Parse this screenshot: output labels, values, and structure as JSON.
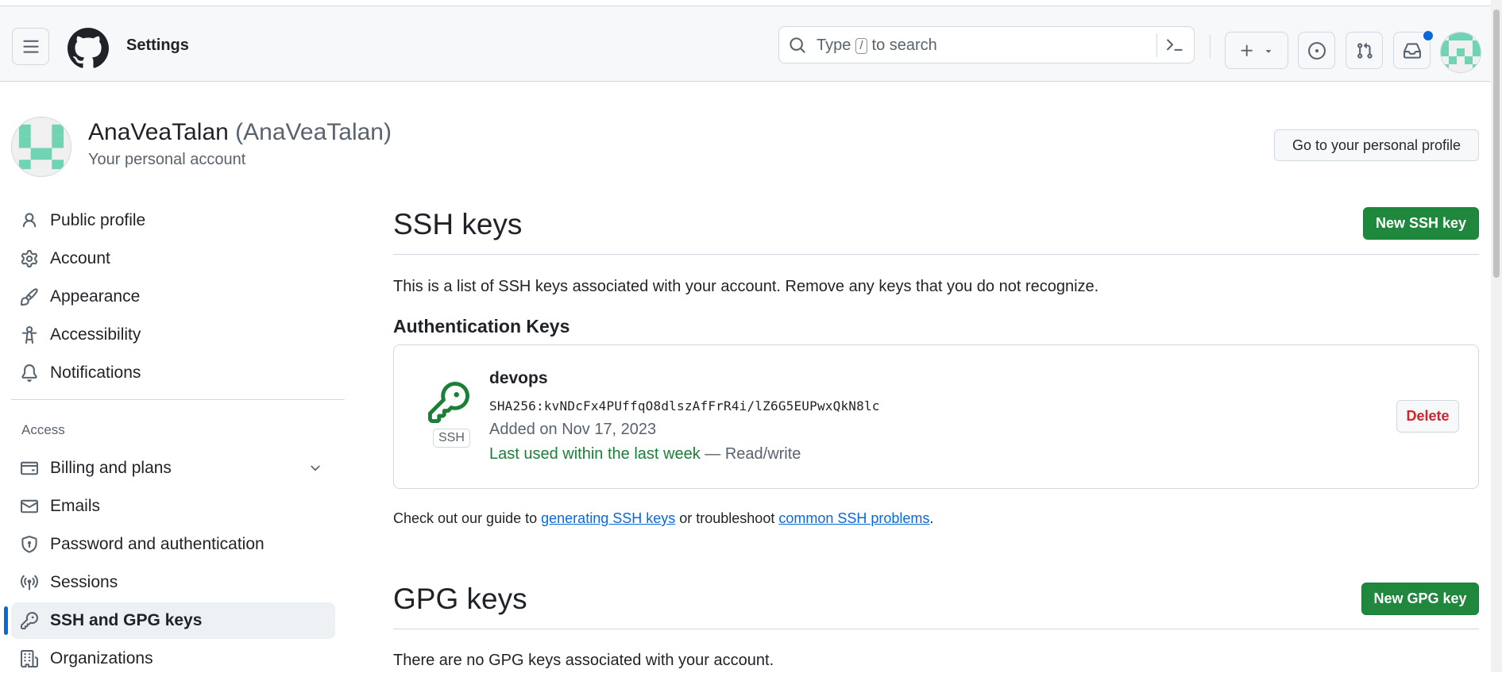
{
  "header": {
    "title": "Settings",
    "search": {
      "prefix": "Type",
      "key": "/",
      "suffix": "to search"
    }
  },
  "profile": {
    "name": "AnaVeaTalan",
    "login": "(AnaVeaTalan)",
    "subtitle": "Your personal account",
    "button": "Go to your personal profile"
  },
  "sidebar": {
    "items": [
      {
        "label": "Public profile",
        "icon": "person-icon"
      },
      {
        "label": "Account",
        "icon": "gear-icon"
      },
      {
        "label": "Appearance",
        "icon": "paintbrush-icon"
      },
      {
        "label": "Accessibility",
        "icon": "accessibility-icon"
      },
      {
        "label": "Notifications",
        "icon": "bell-icon"
      }
    ],
    "access_heading": "Access",
    "access_items": [
      {
        "label": "Billing and plans",
        "icon": "credit-card-icon"
      },
      {
        "label": "Emails",
        "icon": "mail-icon"
      },
      {
        "label": "Password and authentication",
        "icon": "shield-lock-icon"
      },
      {
        "label": "Sessions",
        "icon": "broadcast-icon"
      },
      {
        "label": "SSH and GPG keys",
        "icon": "key-icon",
        "active": true
      },
      {
        "label": "Organizations",
        "icon": "organization-icon"
      }
    ]
  },
  "ssh": {
    "title": "SSH keys",
    "new_button": "New SSH key",
    "description": "This is a list of SSH keys associated with your account. Remove any keys that you do not recognize.",
    "auth_heading": "Authentication Keys",
    "key": {
      "type_label": "SSH",
      "title": "devops",
      "fingerprint": "SHA256:kvNDcFx4PUffqO8dlszAfFrR4i/lZ6G5EUPwxQkN8lc",
      "added": "Added on Nov 17, 2023",
      "last_used": "Last used within the last week",
      "access": "— Read/write",
      "delete_button": "Delete"
    },
    "guide": {
      "prefix": "Check out our guide to",
      "link1": "generating SSH keys",
      "middle": "or troubleshoot",
      "link2": "common SSH problems",
      "suffix": "."
    }
  },
  "gpg": {
    "title": "GPG keys",
    "new_button": "New GPG key",
    "empty": "There are no GPG keys associated with your account."
  },
  "colors": {
    "accent": "#0969da",
    "primary_button": "#1f883d",
    "danger": "#d1242f",
    "identicon": "#6fd3b4"
  }
}
